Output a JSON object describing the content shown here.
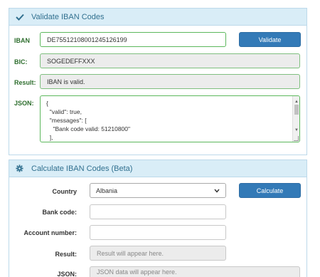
{
  "validate": {
    "title": "Validate IBAN Codes",
    "iban_label": "IBAN",
    "iban_value": "DE75512108001245126199",
    "validate_button": "Validate",
    "bic_label": "BIC:",
    "bic_value": "SOGEDEFFXXX",
    "result_label": "Result:",
    "result_value": "IBAN is valid.",
    "json_label": "JSON:",
    "json_lines": [
      "{",
      "  \"valid\": true,",
      "  \"messages\": [",
      "    \"Bank code valid: 51210800\"",
      "  ],"
    ]
  },
  "calculate": {
    "title": "Calculate IBAN Codes (Beta)",
    "country_label": "Country",
    "country_value": "Albania",
    "calculate_button": "Calculate",
    "bank_code_label": "Bank code:",
    "account_number_label": "Account number:",
    "result_label": "Result:",
    "result_placeholder": "Result will appear here.",
    "json_label": "JSON:",
    "json_placeholder": "JSON data will appear here."
  },
  "colors": {
    "accent": "#337ab7",
    "panel_header": "#d9edf7",
    "success_border": "#5cb85c",
    "label_green": "#2e6e2e"
  },
  "icons": {
    "validate_header": "checkmark-icon",
    "calculate_header": "gear-icon",
    "select_caret": "chevron-down-icon"
  }
}
